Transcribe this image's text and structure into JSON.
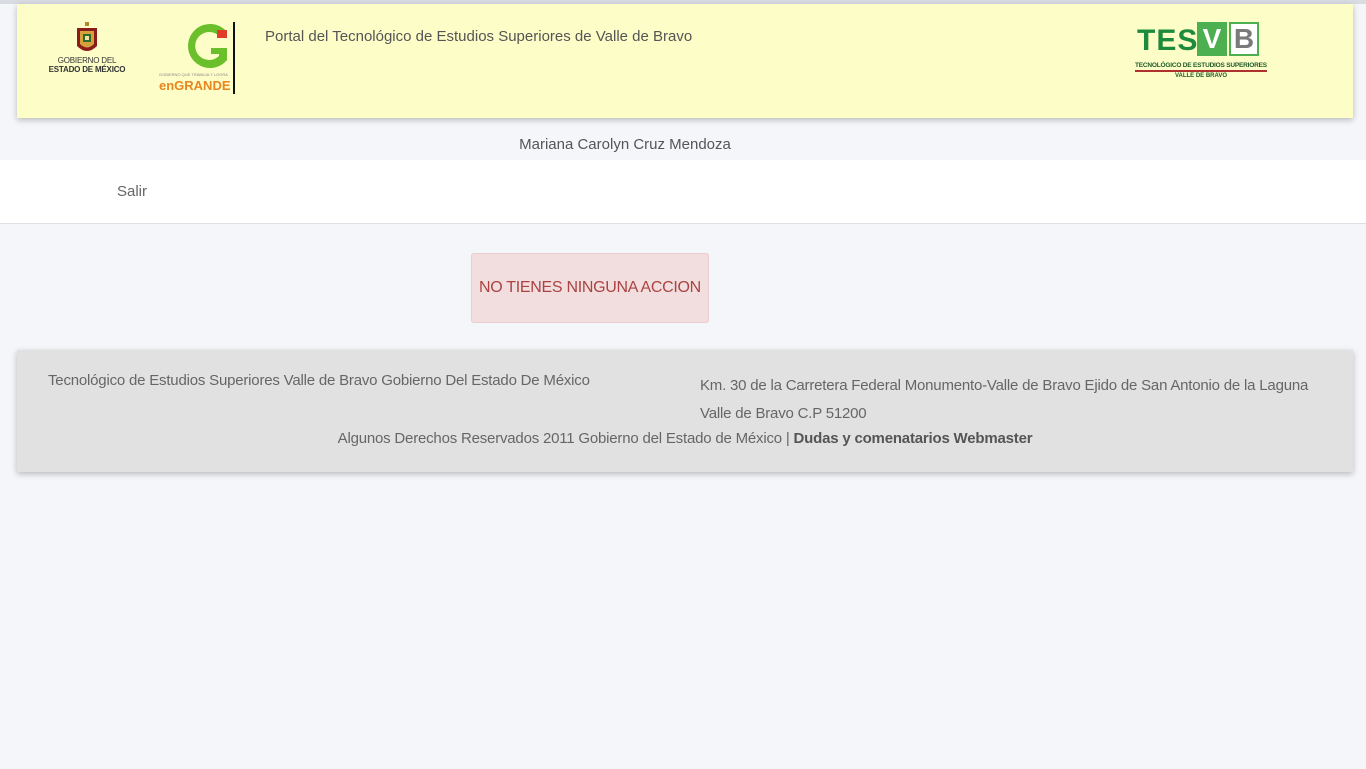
{
  "header": {
    "edomex_logo_line1": "GOBIERNO DEL",
    "edomex_logo_line2": "ESTADO DE MÉXICO",
    "engrande_logo_tagline": "GOBIERNO QUE TRABAJA Y LOGRA",
    "engrande_logo_word": "enGRANDE",
    "portal_title": "Portal del Tecnológico de Estudios Superiores de Valle de Bravo",
    "tesvb_logo_letters": "TES",
    "tesvb_logo_v": "V",
    "tesvb_logo_b": "B",
    "tesvb_logo_line1": "TECNOLÓGICO DE ESTUDIOS SUPERIORES",
    "tesvb_logo_line2": "VALLE DE BRAVO"
  },
  "user": {
    "name": "Mariana Carolyn Cruz Mendoza"
  },
  "nav": {
    "logout_label": "Salir"
  },
  "alert": {
    "message": "NO TIENES NINGUNA ACCION",
    "color": "#a94442"
  },
  "footer": {
    "institution": "Tecnológico de Estudios Superiores Valle de Bravo Gobierno Del Estado De México",
    "address_line1": "Km. 30 de la Carretera Federal Monumento-Valle de Bravo Ejido de San Antonio de la Laguna",
    "address_line2": "Valle de Bravo C.P 51200",
    "rights": "Algunos Derechos Reservados 2011 Gobierno del Estado de México |",
    "webmaster_link": "Dudas y comenatarios Webmaster"
  }
}
